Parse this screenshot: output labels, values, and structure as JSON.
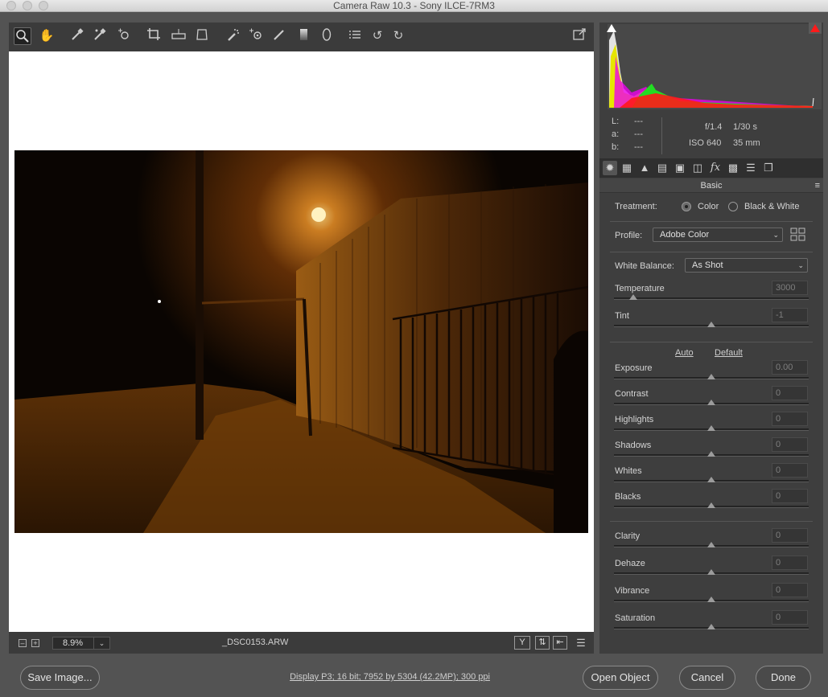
{
  "window": {
    "title": "Camera Raw 10.3  -  Sony ILCE-7RM3"
  },
  "toolbar": {
    "tools": [
      "zoom-tool",
      "hand-tool",
      "white-balance-tool",
      "color-sampler-tool",
      "targeted-adjustment-tool",
      "crop-tool",
      "straighten-tool",
      "transform-tool",
      "spot-removal-tool",
      "red-eye-removal-tool",
      "adjustment-brush-tool",
      "graduated-filter-tool",
      "radial-filter-tool",
      "open-preferences",
      "rotate-ccw",
      "rotate-cw"
    ],
    "fullscreen_icon": "fullscreen-toggle-icon"
  },
  "preview": {
    "zoom": "8.9%",
    "filename": "_DSC0153.ARW",
    "y_label": "Y"
  },
  "info": {
    "lab": {
      "l_label": "L:",
      "a_label": "a:",
      "b_label": "b:",
      "l": "---",
      "a": "---",
      "b": "---"
    },
    "aperture": "f/1.4",
    "shutter": "1/30 s",
    "iso": "ISO 640",
    "focal": "35 mm"
  },
  "panel": {
    "title": "Basic",
    "treatment_label": "Treatment:",
    "treatment_color": "Color",
    "treatment_bw": "Black & White",
    "profile_label": "Profile:",
    "profile_value": "Adobe Color",
    "wb_label": "White Balance:",
    "wb_value": "As Shot",
    "auto": "Auto",
    "default": "Default",
    "sliders": [
      {
        "label": "Temperature",
        "value": "3000",
        "level": 0.1
      },
      {
        "label": "Tint",
        "value": "-1",
        "level": 0.5
      },
      {
        "label": "Exposure",
        "value": "0.00",
        "level": 0.5
      },
      {
        "label": "Contrast",
        "value": "0",
        "level": 0.5
      },
      {
        "label": "Highlights",
        "value": "0",
        "level": 0.5
      },
      {
        "label": "Shadows",
        "value": "0",
        "level": 0.5
      },
      {
        "label": "Whites",
        "value": "0",
        "level": 0.5
      },
      {
        "label": "Blacks",
        "value": "0",
        "level": 0.5
      },
      {
        "label": "Clarity",
        "value": "0",
        "level": 0.5
      },
      {
        "label": "Dehaze",
        "value": "0",
        "level": 0.5
      },
      {
        "label": "Vibrance",
        "value": "0",
        "level": 0.5
      },
      {
        "label": "Saturation",
        "value": "0",
        "level": 0.5
      }
    ]
  },
  "footer": {
    "save": "Save Image...",
    "info_link": "Display P3; 16 bit; 7952 by 5304 (42.2MP); 300 ppi",
    "open": "Open Object",
    "cancel": "Cancel",
    "done": "Done"
  }
}
